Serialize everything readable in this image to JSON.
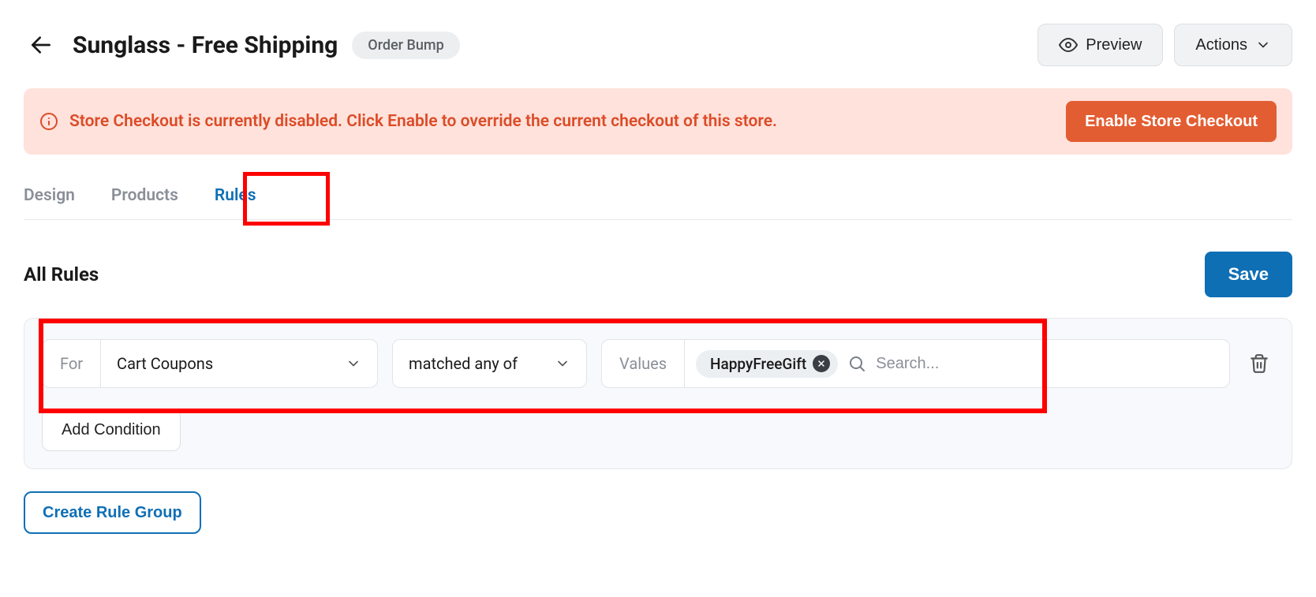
{
  "header": {
    "title": "Sunglass - Free Shipping",
    "badge": "Order Bump",
    "preview_label": "Preview",
    "actions_label": "Actions"
  },
  "alert": {
    "text": "Store Checkout is currently disabled. Click Enable to override the current checkout of this store.",
    "button_label": "Enable Store Checkout"
  },
  "tabs": {
    "design": "Design",
    "products": "Products",
    "rules": "Rules"
  },
  "rules": {
    "title": "All Rules",
    "save_label": "Save",
    "for_label": "For",
    "for_value": "Cart Coupons",
    "match_value": "matched any of",
    "values_label": "Values",
    "chip_value": "HappyFreeGift",
    "search_placeholder": "Search...",
    "add_condition_label": "Add Condition",
    "create_group_label": "Create Rule Group"
  }
}
